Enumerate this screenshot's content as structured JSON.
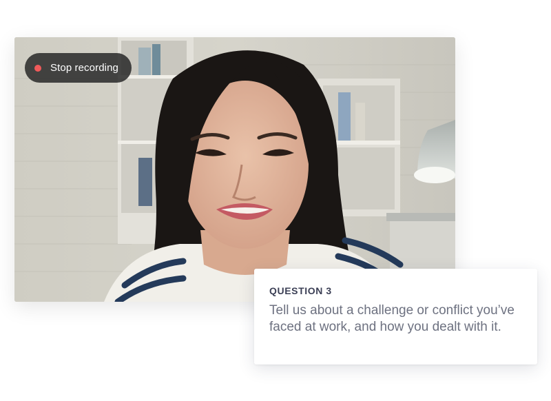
{
  "recording": {
    "stop_label": "Stop recording",
    "indicator_color": "#f05a5a"
  },
  "question": {
    "label": "QUESTION 3",
    "text": "Tell us about a challenge or conflict you’ve faced at work, and how you dealt with it."
  },
  "video": {
    "subject": "webcam-feed"
  }
}
